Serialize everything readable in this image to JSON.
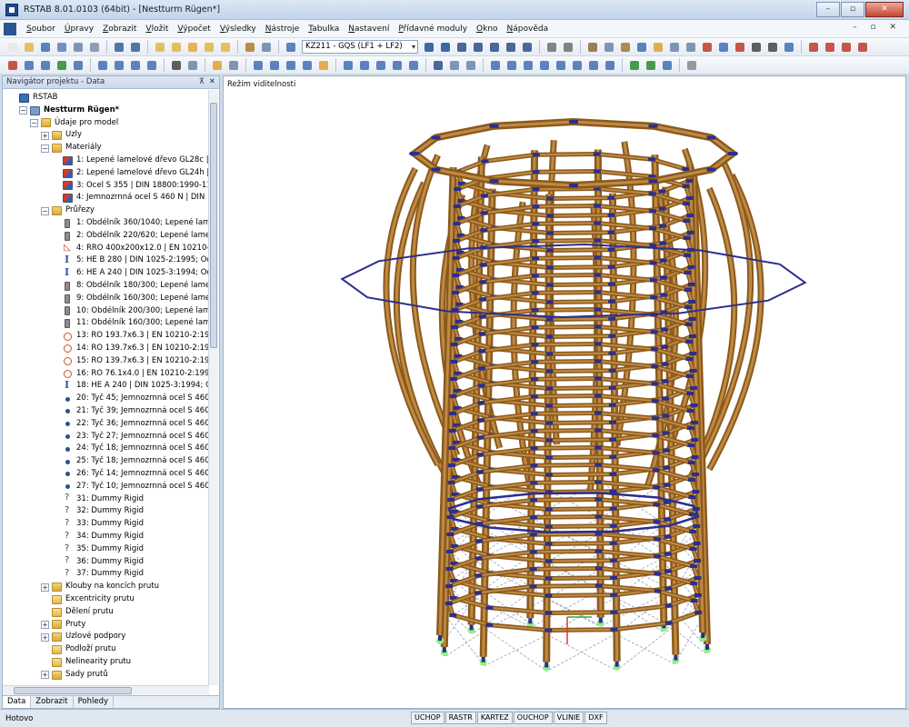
{
  "window": {
    "title": "RSTAB 8.01.0103 (64bit) - [Nestturm Rügen*]",
    "controls": [
      "–",
      "▫",
      "✕"
    ]
  },
  "menu": {
    "items": [
      "Soubor",
      "Úpravy",
      "Zobrazit",
      "Vložit",
      "Výpočet",
      "Výsledky",
      "Nástroje",
      "Tabulka",
      "Nastavení",
      "Přídavné moduly",
      "Okno",
      "Nápověda"
    ],
    "mdi_controls": "– ▫ ✕"
  },
  "toolbar": {
    "load_case": "KZ211 - GQS  (LF1 + LF2)"
  },
  "navigator": {
    "title": "Navigátor projektu - Data",
    "pin": "⊼",
    "close": "✕",
    "tree": [
      {
        "depth": 0,
        "toggle": "",
        "icon": "root",
        "label": "RSTAB"
      },
      {
        "depth": 1,
        "toggle": "−",
        "icon": "model",
        "label": "Nestturm Rügen*",
        "bold": true
      },
      {
        "depth": 2,
        "toggle": "−",
        "icon": "folder",
        "label": "Údaje pro model"
      },
      {
        "depth": 3,
        "toggle": "+",
        "icon": "folder",
        "label": "Uzly"
      },
      {
        "depth": 3,
        "toggle": "−",
        "icon": "folder",
        "label": "Materiály"
      },
      {
        "depth": 4,
        "toggle": "",
        "icon": "mat",
        "label": "1: Lepené lamelové dřevo GL28c | DIN"
      },
      {
        "depth": 4,
        "toggle": "",
        "icon": "mat",
        "label": "2: Lepené lamelové dřevo GL24h | DIN"
      },
      {
        "depth": 4,
        "toggle": "",
        "icon": "mat",
        "label": "3: Ocel S 355 | DIN 18800:1990-11"
      },
      {
        "depth": 4,
        "toggle": "",
        "icon": "mat",
        "label": "4: Jemnozrnná ocel S 460 N | DIN 18800"
      },
      {
        "depth": 3,
        "toggle": "−",
        "icon": "folder",
        "label": "Průřezy"
      },
      {
        "depth": 4,
        "toggle": "",
        "icon": "rect",
        "label": "1: Obdélník 360/1040; Lepené lamelov"
      },
      {
        "depth": 4,
        "toggle": "",
        "icon": "rect",
        "label": "2: Obdélník 220/620; Lepené lamelové"
      },
      {
        "depth": 4,
        "toggle": "",
        "icon": "rro",
        "label": "4: RRO 400x200x12.0 | EN 10210-2:1997;"
      },
      {
        "depth": 4,
        "toggle": "",
        "icon": "ibeam",
        "label": "5: HE B 280 | DIN 1025-2:1995; Ocel S 3"
      },
      {
        "depth": 4,
        "toggle": "",
        "icon": "ibeam",
        "label": "6: HE A 240 | DIN 1025-3:1994; Ocel S 3"
      },
      {
        "depth": 4,
        "toggle": "",
        "icon": "rect",
        "label": "8: Obdélník 180/300; Lepené lamelové"
      },
      {
        "depth": 4,
        "toggle": "",
        "icon": "rect",
        "label": "9: Obdélník 160/300; Lepené lamelové"
      },
      {
        "depth": 4,
        "toggle": "",
        "icon": "rect",
        "label": "10: Obdélník 200/300; Lepené lamelov"
      },
      {
        "depth": 4,
        "toggle": "",
        "icon": "rect",
        "label": "11: Obdélník 160/300; Lepené lamelov"
      },
      {
        "depth": 4,
        "toggle": "",
        "icon": "ro",
        "label": "13: RO 193.7x6.3 | EN 10210-2:1997; Oc"
      },
      {
        "depth": 4,
        "toggle": "",
        "icon": "ro",
        "label": "14: RO 139.7x6.3 | EN 10210-2:1997; Oc"
      },
      {
        "depth": 4,
        "toggle": "",
        "icon": "ro",
        "label": "15: RO 139.7x6.3 | EN 10210-2:1997; Oc"
      },
      {
        "depth": 4,
        "toggle": "",
        "icon": "ro",
        "label": "16: RO 76.1x4.0 | EN 10210-2:1997; Oce"
      },
      {
        "depth": 4,
        "toggle": "",
        "icon": "ibeam",
        "label": "18: HE A 240 | DIN 1025-3:1994; Ocel S"
      },
      {
        "depth": 4,
        "toggle": "",
        "icon": "dot",
        "label": "20: Tyč 45; Jemnozrnná ocel S 460 N"
      },
      {
        "depth": 4,
        "toggle": "",
        "icon": "dot",
        "label": "21: Tyč 39; Jemnozrnná ocel S 460 N"
      },
      {
        "depth": 4,
        "toggle": "",
        "icon": "dot",
        "label": "22: Tyč 36; Jemnozrnná ocel S 460 N"
      },
      {
        "depth": 4,
        "toggle": "",
        "icon": "dot",
        "label": "23: Tyč 27; Jemnozrnná ocel S 460 N"
      },
      {
        "depth": 4,
        "toggle": "",
        "icon": "dot",
        "label": "24: Tyč 18; Jemnozrnná ocel S 460 N"
      },
      {
        "depth": 4,
        "toggle": "",
        "icon": "dot",
        "label": "25: Tyč 18; Jemnozrnná ocel S 460 N"
      },
      {
        "depth": 4,
        "toggle": "",
        "icon": "dot",
        "label": "26: Tyč 14; Jemnozrnná ocel S 460 N"
      },
      {
        "depth": 4,
        "toggle": "",
        "icon": "dot",
        "label": "27: Tyč 10; Jemnozrnná ocel S 460 N"
      },
      {
        "depth": 4,
        "toggle": "",
        "icon": "q",
        "label": "31: Dummy Rigid"
      },
      {
        "depth": 4,
        "toggle": "",
        "icon": "q",
        "label": "32: Dummy Rigid"
      },
      {
        "depth": 4,
        "toggle": "",
        "icon": "q",
        "label": "33: Dummy Rigid"
      },
      {
        "depth": 4,
        "toggle": "",
        "icon": "q",
        "label": "34: Dummy Rigid"
      },
      {
        "depth": 4,
        "toggle": "",
        "icon": "q",
        "label": "35: Dummy Rigid"
      },
      {
        "depth": 4,
        "toggle": "",
        "icon": "q",
        "label": "36: Dummy Rigid"
      },
      {
        "depth": 4,
        "toggle": "",
        "icon": "q",
        "label": "37: Dummy Rigid"
      },
      {
        "depth": 3,
        "toggle": "+",
        "icon": "folder",
        "label": "Klouby na koncích prutu"
      },
      {
        "depth": 3,
        "toggle": "",
        "icon": "doc",
        "label": "Excentricity prutu"
      },
      {
        "depth": 3,
        "toggle": "",
        "icon": "doc",
        "label": "Dělení prutu"
      },
      {
        "depth": 3,
        "toggle": "+",
        "icon": "folder",
        "label": "Pruty"
      },
      {
        "depth": 3,
        "toggle": "+",
        "icon": "folder",
        "label": "Uzlové podpory"
      },
      {
        "depth": 3,
        "toggle": "",
        "icon": "doc",
        "label": "Podloží prutu"
      },
      {
        "depth": 3,
        "toggle": "",
        "icon": "doc",
        "label": "Nelinearity prutu"
      },
      {
        "depth": 3,
        "toggle": "+",
        "icon": "folder",
        "label": "Sady prutů"
      }
    ],
    "tabs": [
      "Data",
      "Zobrazit",
      "Pohledy"
    ]
  },
  "viewport": {
    "mode_label": "Režim viditelnosti",
    "colors": {
      "timber": "#8a5a1c",
      "timber_light": "#c08a44",
      "steel": "#2b2f8c",
      "bracing": "#9aa0b8",
      "support": "#8ff08a"
    }
  },
  "status": {
    "text": "Hotovo",
    "toggles": [
      "UCHOP",
      "RASTR",
      "KARTEZ",
      "OUCHOP",
      "VLINIE",
      "DXF"
    ]
  }
}
